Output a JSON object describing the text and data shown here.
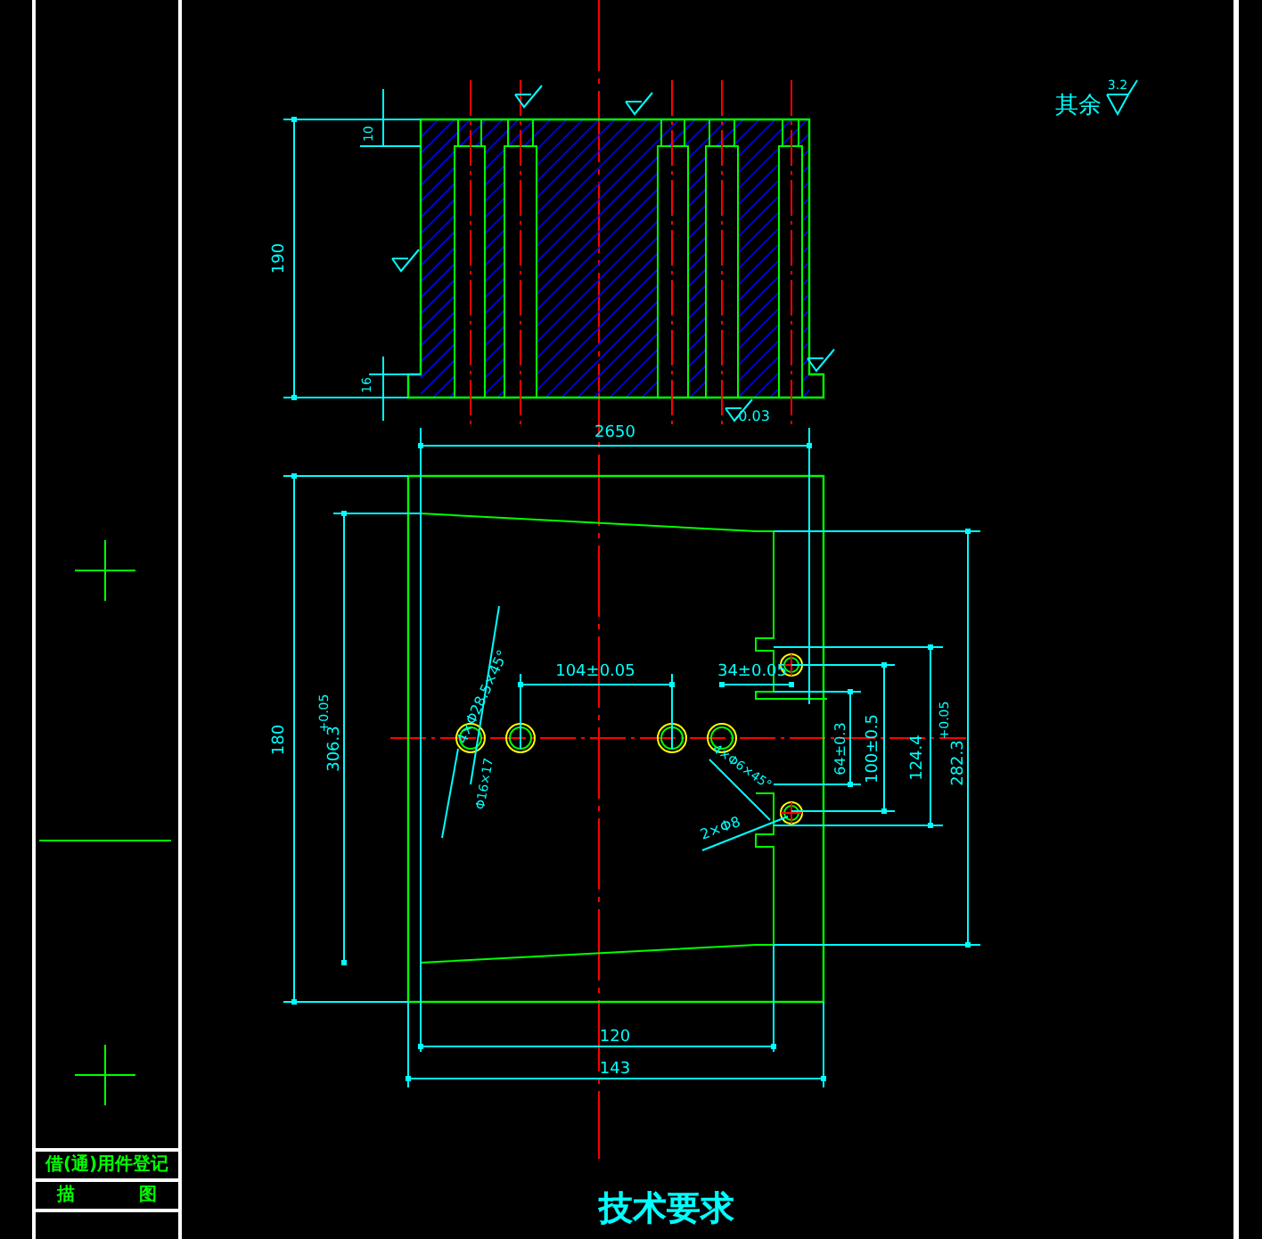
{
  "title_block": {
    "register_label": "借(通)用件登记",
    "trace_left": "描",
    "trace_right": "图"
  },
  "top_view": {
    "labels": [
      "190",
      "10",
      "16",
      "0.03"
    ]
  },
  "plan_view": {
    "labels": [
      "2650",
      "180",
      "306.3",
      "+0.05",
      "104±0.05",
      "34±0.05",
      "64±0.3",
      "100±0.5",
      "124.4",
      "282.3",
      "+0.05",
      "4×Φ28.5×45°",
      "Φ16×17",
      "4×Φ6×45°",
      "2×Φ8",
      "120",
      "143"
    ]
  },
  "roughness_note": {
    "label": "其余",
    "value": "3.2"
  },
  "requirements": {
    "title": "技术要求"
  }
}
